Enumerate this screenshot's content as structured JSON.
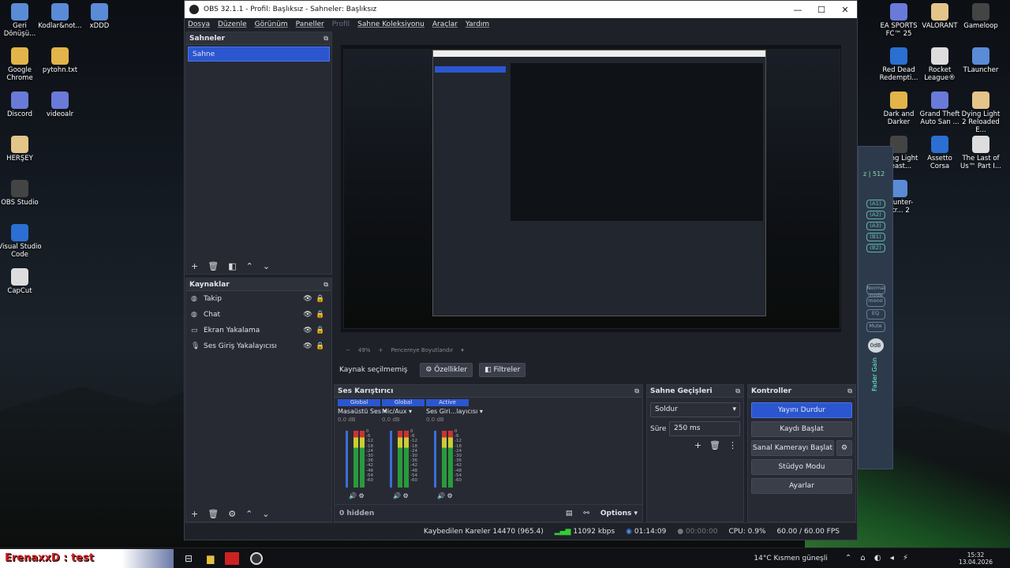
{
  "desktop_left": [
    {
      "label": "Geri Dönüşü...",
      "icon": "recycle-bin-icon"
    },
    {
      "label": "Google Chrome",
      "icon": "chrome-icon"
    },
    {
      "label": "Discord",
      "icon": "discord-icon"
    },
    {
      "label": "HERŞEY",
      "icon": "folder-icon"
    },
    {
      "label": "OBS Studio",
      "icon": "obs-icon"
    },
    {
      "label": "Visual Studio Code",
      "icon": "vscode-icon"
    },
    {
      "label": "CapCut",
      "icon": "capcut-icon"
    }
  ],
  "desktop_left2": [
    {
      "label": "Kodlar&not...",
      "icon": "folder-icon"
    },
    {
      "label": "pytohn.txt",
      "icon": "text-file-icon"
    },
    {
      "label": "videoalr",
      "icon": "folder-icon"
    }
  ],
  "desktop_left3": [
    {
      "label": "xDDD",
      "icon": "folder-icon"
    }
  ],
  "desktop_right": [
    {
      "label": "EA SPORTS FC™ 25",
      "icon": "ea-fc-icon"
    },
    {
      "label": "VALORANT",
      "icon": "valorant-icon"
    },
    {
      "label": "Gameloop",
      "icon": "gameloop-icon"
    },
    {
      "label": "Red Dead Redempti...",
      "icon": "rdr-icon"
    },
    {
      "label": "Rocket League®",
      "icon": "rocket-league-icon"
    },
    {
      "label": "TLauncher",
      "icon": "tlauncher-icon"
    },
    {
      "label": "Dark and Darker",
      "icon": "dark-darker-icon"
    },
    {
      "label": "Grand Theft Auto San ...",
      "icon": "gta-icon"
    },
    {
      "label": "Dying Light 2 Reloaded E...",
      "icon": "dying-light-icon"
    },
    {
      "label": "Dying Light Beast...",
      "icon": "dying-light-beast-icon"
    },
    {
      "label": "Assetto Corsa",
      "icon": "assetto-icon"
    },
    {
      "label": "The Last of Us™ Part I...",
      "icon": "tlou-icon"
    },
    {
      "label": "Counter-Str... 2",
      "icon": "cs2-icon"
    }
  ],
  "window": {
    "title": "OBS 32.1.1 - Profil: Başlıksız - Sahneler: Başlıksız",
    "min": "—",
    "max": "☐",
    "close": "✕"
  },
  "menu": [
    "Dosya",
    "Düzenle",
    "Görünüm",
    "Paneller",
    "Profil",
    "Sahne Koleksiyonu",
    "Araçlar",
    "Yardım"
  ],
  "scenes": {
    "title": "Sahneler",
    "items": [
      "Sahne"
    ]
  },
  "sources": {
    "title": "Kaynaklar",
    "items": [
      {
        "name": "Takip",
        "icon": "browser-icon"
      },
      {
        "name": "Chat",
        "icon": "browser-icon"
      },
      {
        "name": "Ekran Yakalama",
        "icon": "monitor-icon"
      },
      {
        "name": "Ses Giriş Yakalayıcısı",
        "icon": "microphone-icon"
      }
    ]
  },
  "preview": {
    "zoom": "49%",
    "fit": "Pencereye Boyutlandır"
  },
  "props_bar": {
    "no_source": "Kaynak seçilmemiş",
    "properties": "Özellikler",
    "filters": "Filtreler"
  },
  "mixer": {
    "title": "Ses Karıştırıcı",
    "channels": [
      {
        "tag": "Global",
        "name": "Masaüstü Ses",
        "db": "0.0 dB"
      },
      {
        "tag": "Global",
        "name": "Mic/Aux",
        "db": "0.0 dB"
      },
      {
        "tag": "Active",
        "name": "Ses Giri...layıcısı",
        "db": "0.0 dB"
      }
    ],
    "scale": [
      "0",
      "-6",
      "-12",
      "-18",
      "-24",
      "-30",
      "-36",
      "-42",
      "-48",
      "-54",
      "-60"
    ],
    "hidden": "0 hidden",
    "options": "Options"
  },
  "transitions": {
    "title": "Sahne Geçişleri",
    "type": "Soldur",
    "duration_label": "Süre",
    "duration": "250 ms"
  },
  "controls": {
    "title": "Kontroller",
    "buttons": [
      "Yayını Durdur",
      "Kaydı Başlat",
      "Sanal Kamerayı Başlat",
      "Stüdyo Modu",
      "Ayarlar"
    ]
  },
  "status": {
    "dropped": "Kaybedilen Kareler 14470 (965.4)",
    "kbps": "11092 kbps",
    "stream_time": "01:14:09",
    "rec_time": "00:00:00",
    "cpu": "CPU: 0.9%",
    "fps": "60.00 / 60.00 FPS"
  },
  "voicemeeter": {
    "label": "z | 512",
    "buses": [
      "A1",
      "A2",
      "A3",
      "B1",
      "B2"
    ],
    "modes": [
      "Normal mode",
      "mono",
      "EQ",
      "Mute"
    ],
    "gain": "0dB",
    "fader": "Fader Gain"
  },
  "taskbar": {
    "stream_label": "ErenaxxD : test",
    "weather": "14°C  Kısmen güneşli",
    "time": "15:32",
    "date": "13.04.2026"
  }
}
